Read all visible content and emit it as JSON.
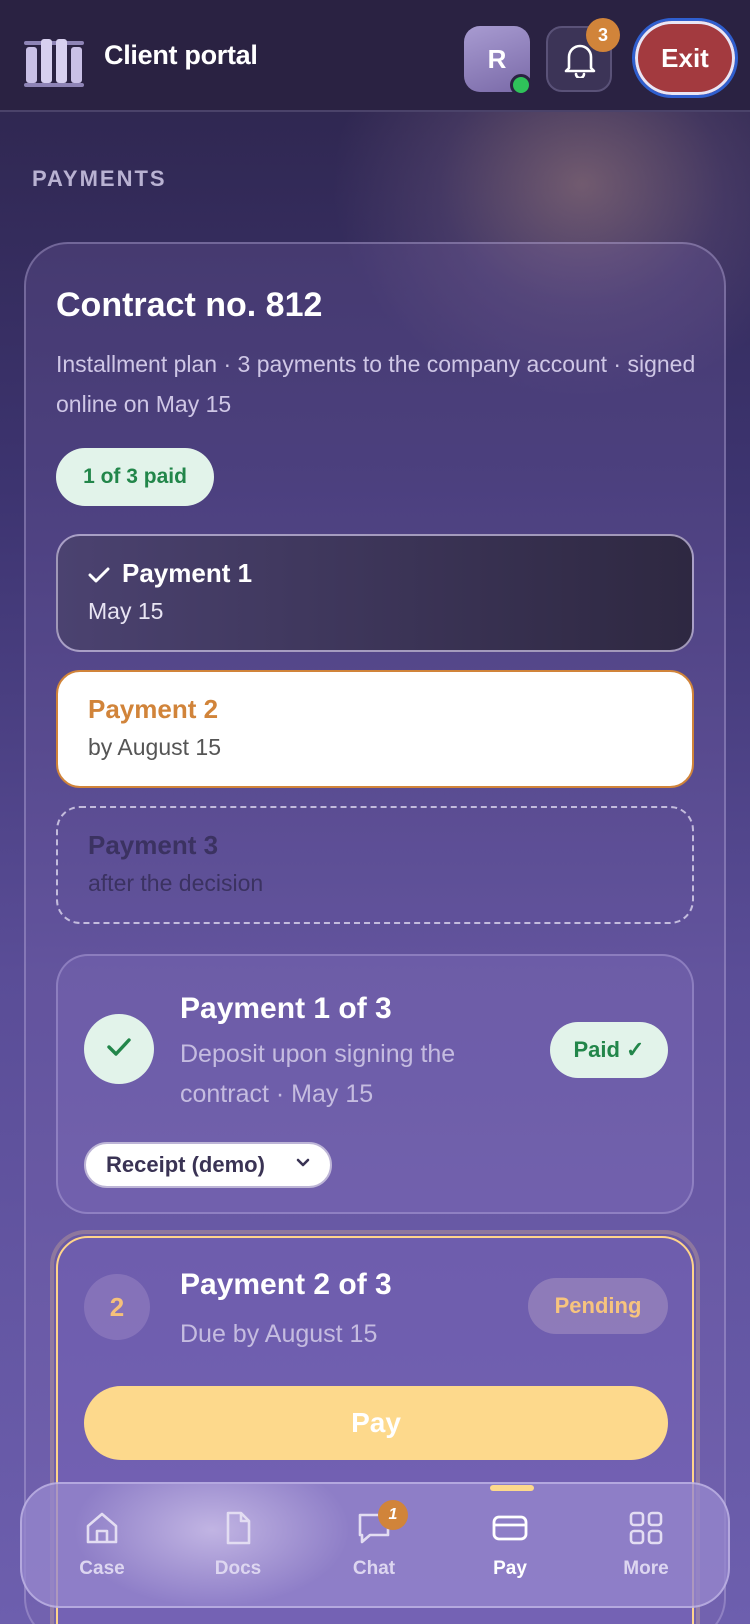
{
  "header": {
    "app_title": "Client portal",
    "avatar_initial": "R",
    "notifications_count": "3",
    "exit_label": "Exit"
  },
  "section_title": "PAYMENTS",
  "contract": {
    "title": "Contract no. 812",
    "subtitle": "Installment plan · 3 payments to the company account · signed online on May 15",
    "progress_pill": "1 of 3 paid",
    "progress_fraction": 0.333
  },
  "timeline": [
    {
      "title": "Payment 1",
      "date": "May 15",
      "state": "done"
    },
    {
      "title": "Payment 2",
      "date": "by August 15",
      "state": "current"
    },
    {
      "title": "Payment 3",
      "date": "after the decision",
      "state": "future"
    }
  ],
  "payments": [
    {
      "title": "Payment 1 of 3",
      "description": "Deposit upon signing the contract · May 15",
      "status": "Paid ✓",
      "receipt_label": "Receipt (demo)"
    },
    {
      "number": "2",
      "title": "Payment 2 of 3",
      "description": "Due by August 15",
      "status": "Pending",
      "action_label": "Pay"
    }
  ],
  "nav": {
    "items": [
      {
        "label": "Case",
        "icon": "home-icon"
      },
      {
        "label": "Docs",
        "icon": "document-icon"
      },
      {
        "label": "Chat",
        "icon": "chat-icon",
        "badge": "1"
      },
      {
        "label": "Pay",
        "icon": "card-icon",
        "active": true
      },
      {
        "label": "More",
        "icon": "grid-icon"
      }
    ]
  },
  "colors": {
    "accent_orange": "#d1843a",
    "paid_green": "#22864a",
    "exit_red": "#a33a3f",
    "pay_yellow": "#fdd98c"
  }
}
